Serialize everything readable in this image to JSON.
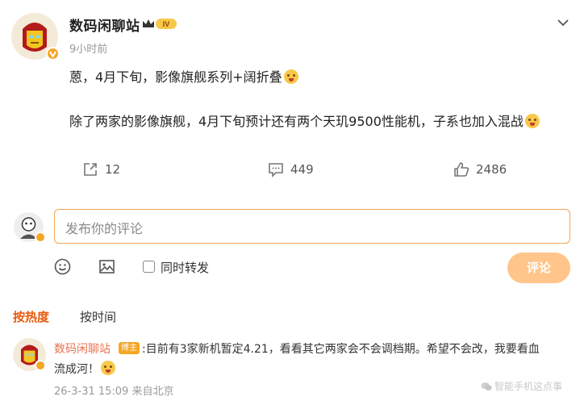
{
  "post": {
    "author": "数码闲聊站",
    "level_badge": "IV",
    "time": "9小时前",
    "line1": "蒽，4月下旬，影像旗舰系列+阔折叠",
    "line2": "除了两家的影像旗舰，4月下旬预计还有两个天玑9500性能机，子系也加入混战",
    "repost_count": "12",
    "comment_count": "449",
    "like_count": "2486"
  },
  "composer": {
    "placeholder": "发布你的评论",
    "also_repost_label": "同时转发",
    "submit_label": "评论"
  },
  "sort": {
    "hot": "按热度",
    "time": "按时间"
  },
  "comment": {
    "author": "数码闲聊站",
    "tag": "博主",
    "text_line1": ":目前有3家新机暂定4.21，看看其它两家会不会调档期。希望不会改，我要看血",
    "text_line2": "流成河！",
    "meta": "26-3-31 15:09 来自北京"
  },
  "watermark": "智能手机这点事",
  "colors": {
    "accent": "#e8590c",
    "name_link": "#eb7350",
    "input_border": "#f5a656",
    "submit_bg": "#ffc58a",
    "verified_badge": "#f5a623"
  },
  "icons": [
    "ironman-avatar",
    "verified-badge-icon",
    "crown-level-icon",
    "chevron-down-icon",
    "repost-icon",
    "comment-icon",
    "like-icon",
    "emoji-icon",
    "image-icon",
    "user-avatar"
  ]
}
